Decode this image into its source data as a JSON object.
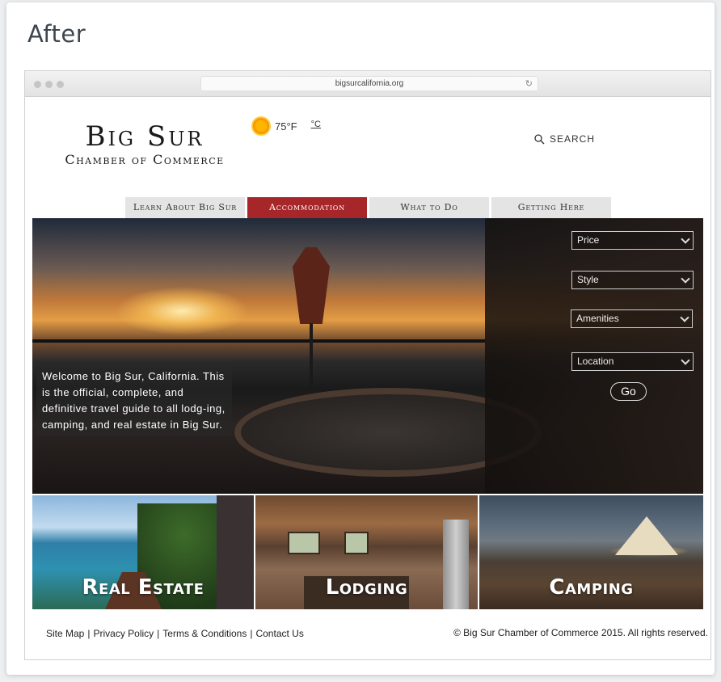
{
  "card": {
    "title": "After"
  },
  "browser": {
    "url": "bigsurcalifornia.org",
    "reload_icon": "reload-icon"
  },
  "logo": {
    "line1": "Big Sur",
    "line2": "Chamber of Commerce"
  },
  "weather": {
    "icon": "sun-icon",
    "temperature": "75°F",
    "alt_unit": "°C"
  },
  "search": {
    "label": "SEARCH",
    "icon": "search-icon"
  },
  "nav": {
    "tabs": [
      {
        "label": "Learn About Big Sur",
        "active": false
      },
      {
        "label": "Accommodation",
        "active": true
      },
      {
        "label": "What to Do",
        "active": false
      },
      {
        "label": "Getting Here",
        "active": false
      }
    ],
    "active_color": "#a6262a"
  },
  "hero": {
    "welcome_text": "Welcome to Big Sur, California. This is the official, complete, and definitive travel guide to all lodg-ing, camping, and real estate in Big Sur.",
    "filters": [
      "Price",
      "Style",
      "Amenities",
      "Location"
    ],
    "go_label": "Go"
  },
  "tiles": [
    {
      "label": "Real Estate"
    },
    {
      "label": "Lodging"
    },
    {
      "label": "Camping"
    }
  ],
  "footer": {
    "links": [
      "Site Map",
      "Privacy Policy",
      "Terms & Conditions",
      "Contact Us"
    ],
    "copyright": "© Big Sur Chamber of Commerce 2015. All rights reserved."
  }
}
